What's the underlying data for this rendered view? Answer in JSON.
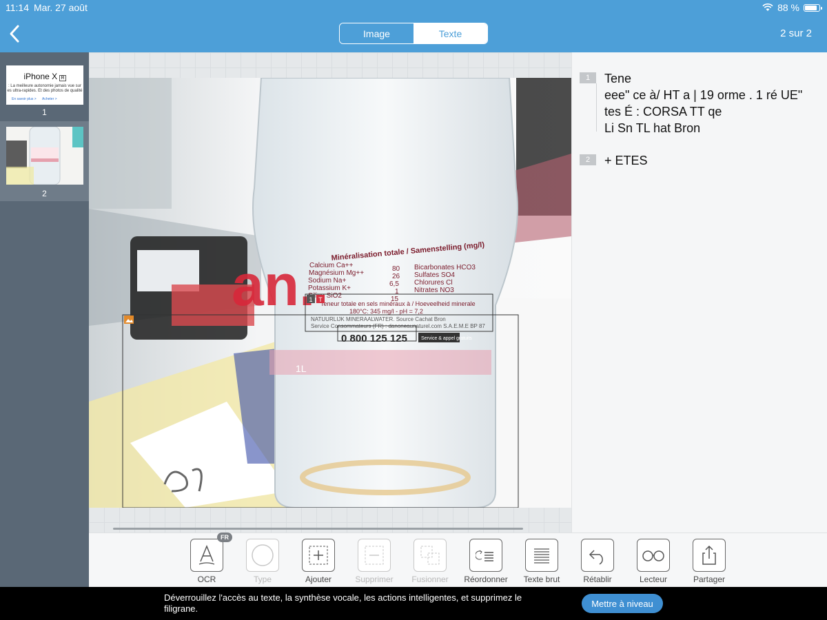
{
  "status_bar": {
    "time": "11:14",
    "date": "Mar. 27 août",
    "battery": "88 %",
    "battery_level": 0.88
  },
  "nav": {
    "segments": [
      {
        "label": "Image",
        "selected": true
      },
      {
        "label": "Texte",
        "selected": false
      }
    ],
    "page_count": "2 sur 2"
  },
  "thumbnails": [
    {
      "number": "1",
      "title": "iPhone X",
      "badge": "R",
      "text1": ": La meilleure autonomie jamais vue sur",
      "text2": "es ultra-rapides. Et des photos de qualité",
      "link1": "En savoir plus >",
      "link2": "Acheter >"
    },
    {
      "number": "2"
    }
  ],
  "image_overlay": {
    "block_numbers": [
      "1",
      "T"
    ],
    "label_heading": "Minéralisation totale / Samenstelling (mg/l)",
    "label_rows": [
      [
        "Calcium Ca++",
        "80",
        "Bicarbonates HCO3"
      ],
      [
        "Magnésium Mg++",
        "26",
        "Sulfates SO4"
      ],
      [
        "Sodium Na+",
        "6,5",
        "Chlorures Cl"
      ],
      [
        "Potassium K+",
        "1",
        "Nitrates NO3"
      ],
      [
        "Silice SiO2",
        "15",
        ""
      ]
    ],
    "label_line1": "Teneur totale en sels minéraux à / Hoeveelheid minerale",
    "label_line2": "180°C: 345 mg/l - pH = 7,2",
    "label_line3": "NATUURLIJK MINERAALWATER. Source Cachat Bron",
    "label_line4": "Service Consommateurs (FR) : danoneaunaturel.com S.A.E.M.E BP 87",
    "phone": "0 800 125 125",
    "phone_tag": "Service & appel gratuits",
    "brand_fragment": "an.",
    "volume": "1L"
  },
  "ocr_blocks": [
    {
      "number": "1",
      "lines": [
        "Tene",
        "eee\" ce à/ HT a | 19 orme . 1 ré UE\"",
        "tes É : CORSA TT qe",
        "Li Sn TL hat Bron"
      ]
    },
    {
      "number": "2",
      "lines": [
        "+ ETES"
      ]
    }
  ],
  "toolbar": {
    "ocr_badge": "FR",
    "tools": [
      {
        "label": "OCR",
        "icon": "ocr-icon",
        "enabled": true
      },
      {
        "label": "Type",
        "icon": "circle-icon",
        "enabled": false
      },
      {
        "label": "Ajouter",
        "icon": "add-box-icon",
        "enabled": true
      },
      {
        "label": "Supprimer",
        "icon": "remove-box-icon",
        "enabled": false
      },
      {
        "label": "Fusionner",
        "icon": "merge-icon",
        "enabled": false
      },
      {
        "label": "Réordonner",
        "icon": "reorder-icon",
        "enabled": true
      },
      {
        "label": "Texte brut",
        "icon": "plain-text-icon",
        "enabled": true
      },
      {
        "label": "Rétablir",
        "icon": "undo-icon",
        "enabled": true
      },
      {
        "label": "Lecteur",
        "icon": "glasses-icon",
        "enabled": true
      },
      {
        "label": "Partager",
        "icon": "share-icon",
        "enabled": true
      }
    ]
  },
  "banner": {
    "text": "Déverrouillez l'accès au texte, la synthèse vocale, les actions intelligentes, et supprimez le filigrane.",
    "button": "Mettre à niveau"
  },
  "colors": {
    "header": "#4d9fd8",
    "sidebar": "#5a6876",
    "accent_button": "#3f8fd2",
    "selection_box": "#333333"
  }
}
